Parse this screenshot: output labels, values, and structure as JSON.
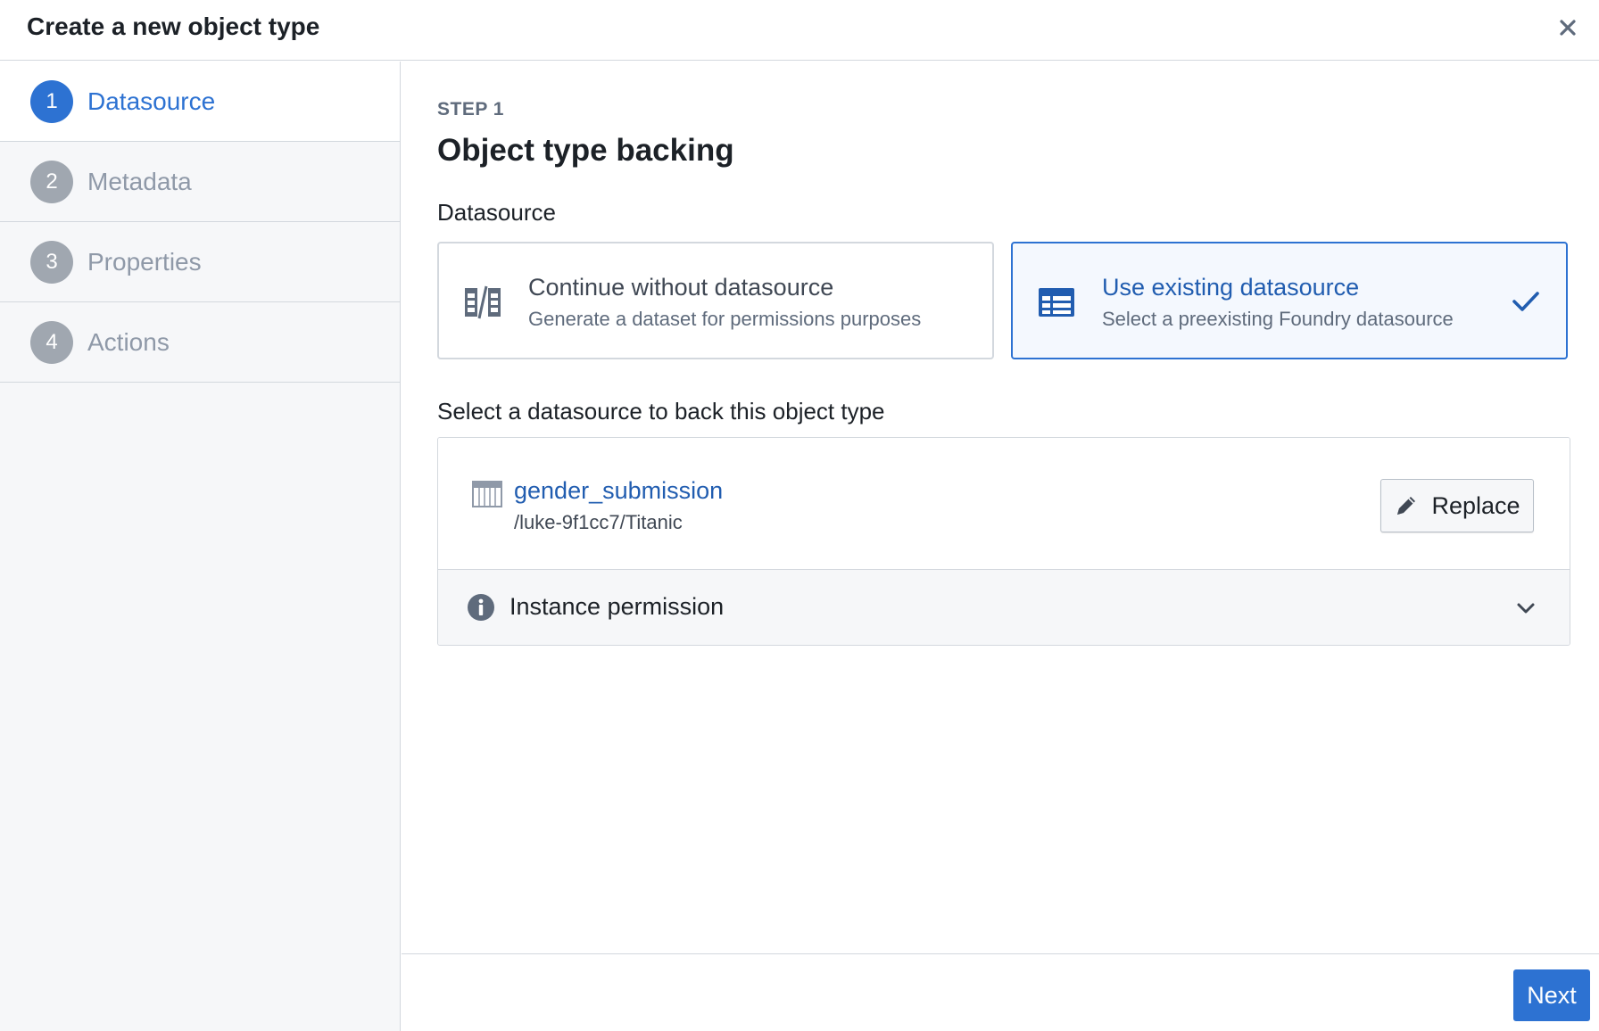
{
  "dialog": {
    "title": "Create a new object type",
    "close_icon": "close-icon"
  },
  "sidebar": {
    "steps": [
      {
        "number": "1",
        "label": "Datasource",
        "active": true
      },
      {
        "number": "2",
        "label": "Metadata",
        "active": false
      },
      {
        "number": "3",
        "label": "Properties",
        "active": false
      },
      {
        "number": "4",
        "label": "Actions",
        "active": false
      }
    ]
  },
  "main": {
    "step_kicker": "STEP 1",
    "title": "Object type backing",
    "datasource_label": "Datasource",
    "options": [
      {
        "icon": "split-dataset-icon",
        "title": "Continue without datasource",
        "subtitle": "Generate a dataset for permissions purposes",
        "selected": false
      },
      {
        "icon": "table-icon",
        "title": "Use existing datasource",
        "subtitle": "Select a preexisting Foundry datasource",
        "selected": true
      }
    ],
    "select_label": "Select a datasource to back this object type",
    "datasource": {
      "name": "gender_submission",
      "path": "/luke-9f1cc7/Titanic",
      "replace_label": "Replace"
    },
    "instance_permission_label": "Instance permission"
  },
  "footer": {
    "next_label": "Next"
  },
  "colors": {
    "accent": "#2d72d2",
    "link": "#215db0",
    "border": "#d3d8de",
    "sidebar_bg": "#f6f7f9"
  }
}
